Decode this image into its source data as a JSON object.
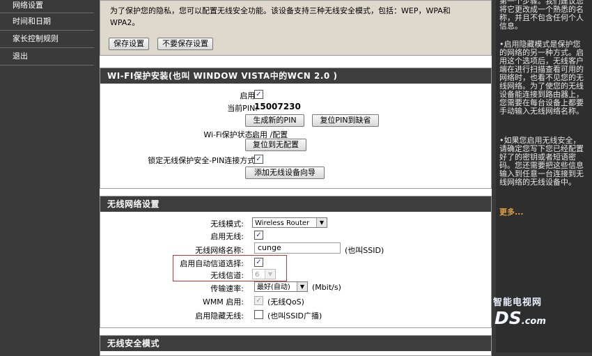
{
  "sidebar": {
    "items": [
      {
        "label": "网络设置"
      },
      {
        "label": "时间和日期"
      },
      {
        "label": "家长控制规则"
      },
      {
        "label": "退出"
      }
    ]
  },
  "intro": {
    "text": "为了保护您的隐私，您可以配置无线安全功能。该设备支持三种无线安全模式，包括：WEP，WPA和WPA2。",
    "save_label": "保存设置",
    "nosave_label": "不要保存设置"
  },
  "wps": {
    "title": "WI-FI保护安装(也叫 WINDOW VISTA中的WCN 2.0 )",
    "enable_label": "启用:",
    "enable_checked": true,
    "pin_label": "当前PIN:",
    "pin_value": "15007230",
    "gen_pin_label": "生成新的PIN",
    "reset_pin_label": "复位PIN到缺省",
    "status_label": "Wi-Fi保护状态::",
    "status_value": "启用 /配置",
    "reset_unconf_label": "复位到无配置",
    "lock_label": "锁定无线保护安全-PIN连接方式:",
    "lock_checked": true,
    "add_device_label": "添加无线设备向导"
  },
  "wireless": {
    "title": "无线网络设置",
    "mode_label": "无线模式:",
    "mode_value": "Wireless Router",
    "enable_label": "启用无线:",
    "enable_checked": true,
    "ssid_label": "无线网络名称:",
    "ssid_value": "cunge",
    "ssid_note": "(也叫SSID)",
    "auto_channel_label": "启用自动信道选择:",
    "auto_channel_checked": true,
    "channel_label": "无线信道:",
    "channel_value": "6",
    "rate_label": "传输速率:",
    "rate_value": "最好(自动)",
    "rate_unit": "(Mbit/s)",
    "wmm_label": "WMM 启用:",
    "wmm_note": "(无线QoS)",
    "hidden_label": "启用隐藏无线:",
    "hidden_note": "(也叫SSID广播)"
  },
  "security": {
    "title": "无线安全模式"
  },
  "help": {
    "para1": "第一个步骤。我们建议您将它更改成一个熟悉的名称，并且不包含任何个人信息。",
    "para2": "•启用隐藏模式是保护您的网络的另一种方式。启用这个选项后，无线客户端在进行扫描查看可用的网络时，也看不见您的无线网络。为了使您的无线设备能连接到路由器上，您需要在每台设备上都要手动输入无线网络名称。",
    "para3": "•如果您启用无线安全，请确定您写下您已经配置好了的密钥或者短语密码。您还需要把这些信息输入到任意一台连接到无线网络的无线设备中。",
    "more": "更多..."
  },
  "watermark": {
    "line1": "智能电视网",
    "line2": "DS",
    "line2_suffix": ".com"
  }
}
